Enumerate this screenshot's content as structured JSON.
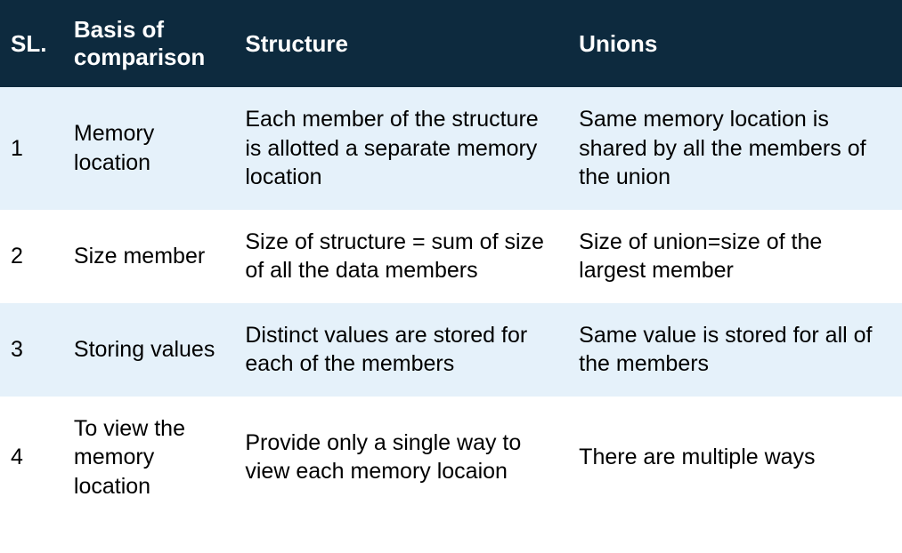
{
  "table": {
    "headers": {
      "sl": "SL.",
      "basis": "Basis of comparison",
      "structure": "Structure",
      "unions": "Unions"
    },
    "rows": [
      {
        "sl": "1",
        "basis": "Memory location",
        "structure": "Each member of the structure is allotted a separate memory location",
        "unions": "Same memory location is shared by all the members of the union"
      },
      {
        "sl": "2",
        "basis": "Size member",
        "structure": "Size of structure = sum of size of all the data members",
        "unions": "Size of union=size of the largest member"
      },
      {
        "sl": "3",
        "basis": "Storing values",
        "structure": "Distinct values are stored for each of the members",
        "unions": "Same value is stored for all of the members"
      },
      {
        "sl": "4",
        "basis": "To view the memory location",
        "structure": "Provide only a single way to view each memory locaion",
        "unions": "There are multiple ways"
      }
    ]
  }
}
